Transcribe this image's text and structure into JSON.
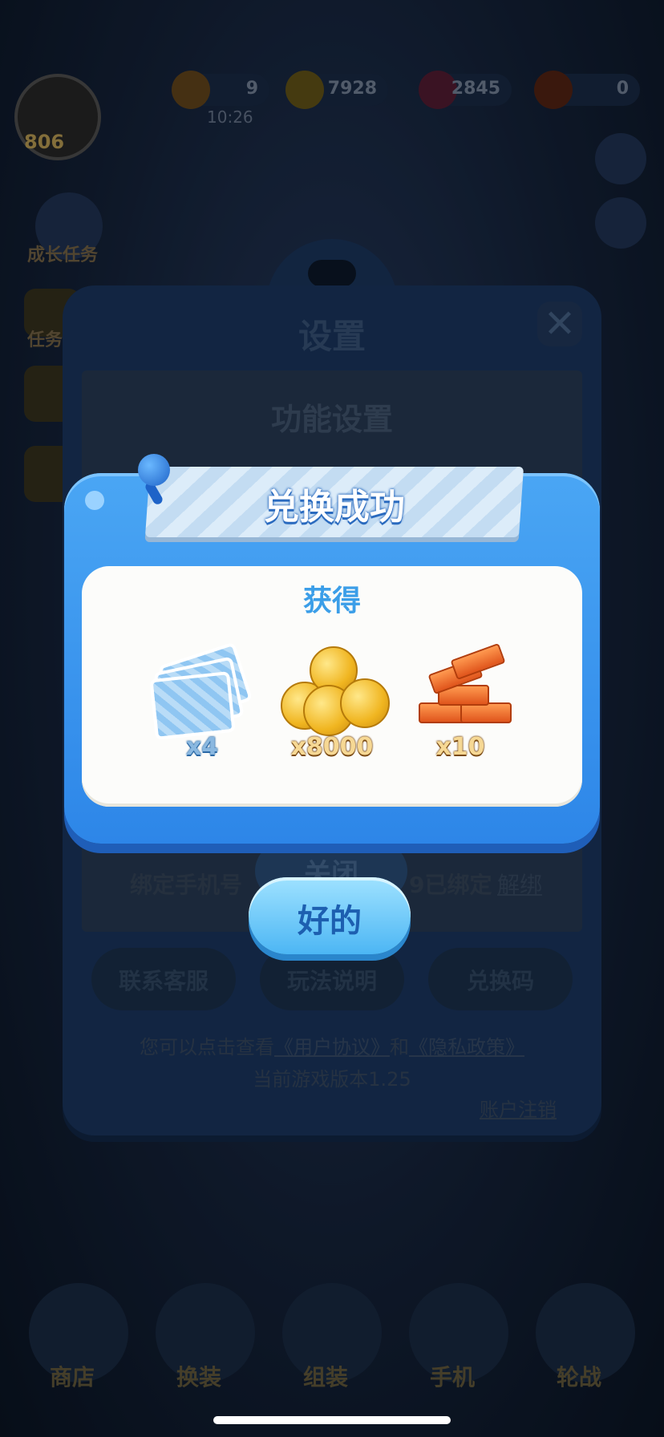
{
  "hud": {
    "level": "806",
    "resources": [
      {
        "name": "heart-icon",
        "value": "9"
      },
      {
        "name": "coin-icon",
        "value": "7928"
      },
      {
        "name": "gem-icon",
        "value": "2845"
      },
      {
        "name": "gold-bar-icon",
        "value": "0"
      }
    ],
    "timer": "10:26"
  },
  "side": {
    "growth_task": "成长任务",
    "task": "任务"
  },
  "settings": {
    "title": "设置",
    "section_title": "功能设置",
    "bind_phone_label": "绑定手机号",
    "bound_status": "9已绑定",
    "unbind_link": "解绑",
    "close_button": "关闭",
    "contact_support": "联系客服",
    "how_to_play": "玩法说明",
    "redeem_code": "兑换码",
    "footer_prefix": "您可以点击查看",
    "user_agreement": "《用户协议》",
    "footer_and": "和",
    "privacy_policy": "《隐私政策》",
    "version": "当前游戏版本1.25",
    "account_cancel": "账户注销"
  },
  "bottom_nav": [
    "商店",
    "换装",
    "组装",
    "手机",
    "轮战"
  ],
  "modal": {
    "title": "兑换成功",
    "obtained_label": "获得",
    "rewards": [
      {
        "icon": "card-pack-icon",
        "qty": "x4"
      },
      {
        "icon": "coin-pile-icon",
        "qty": "x8000"
      },
      {
        "icon": "gold-bar-pile-icon",
        "qty": "x10"
      }
    ],
    "ok_button": "好的"
  },
  "colors": {
    "modal_blue": "#2d86e8",
    "title_blue": "#3b9ee8",
    "ok_text": "#1d5fb0"
  }
}
